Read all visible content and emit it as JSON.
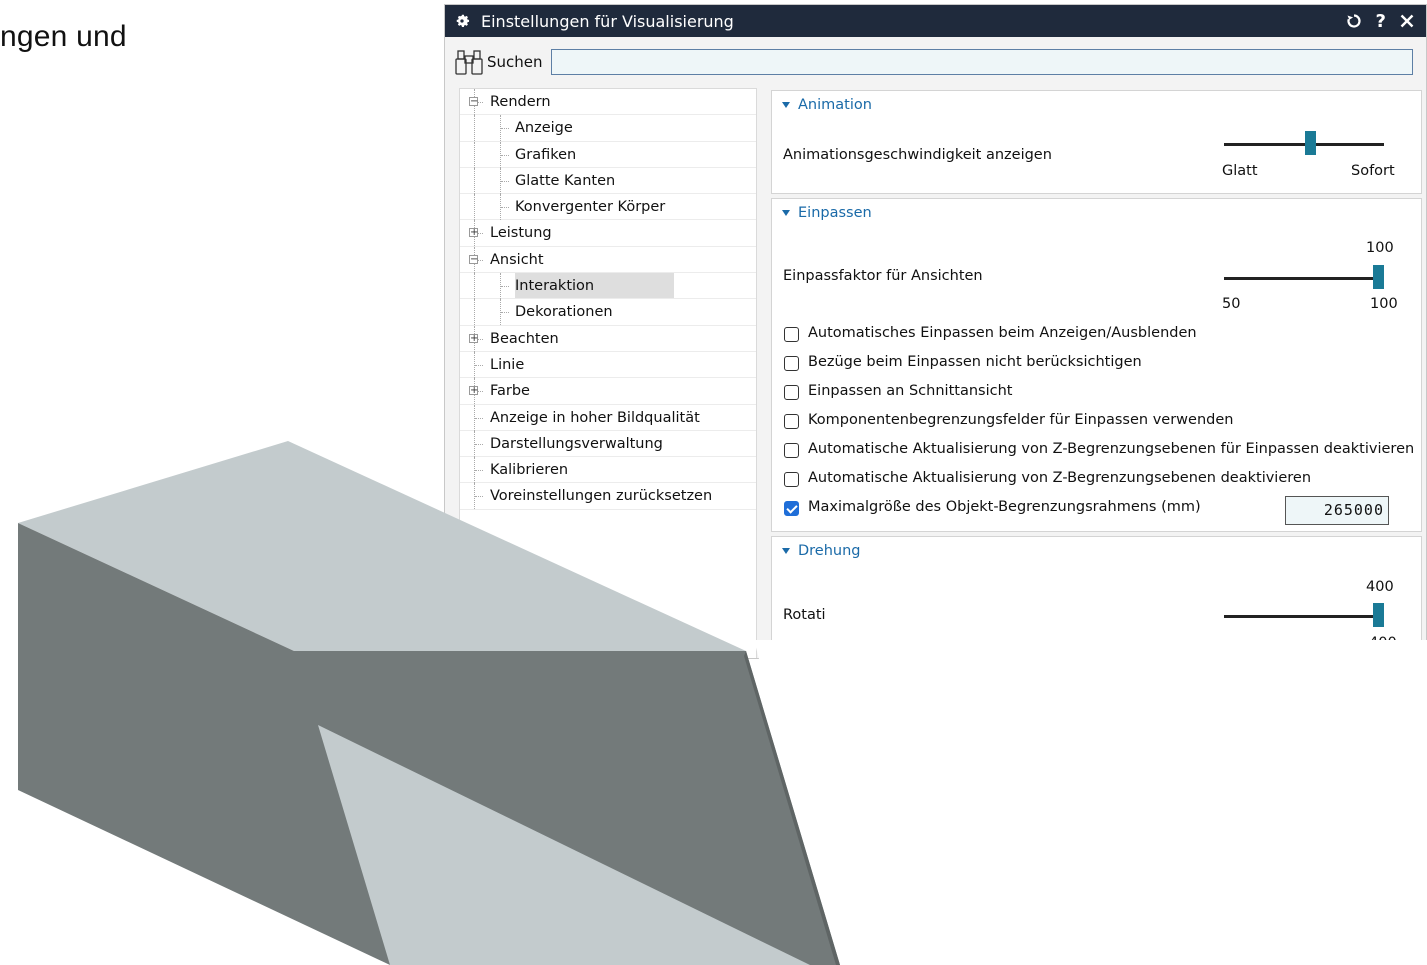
{
  "background": {
    "text": "ngen und"
  },
  "dialog": {
    "title": "Einstellungen für Visualisierung",
    "icons": [
      "gear-icon",
      "reset-icon",
      "help-icon",
      "close-icon"
    ],
    "help_label": "?",
    "search": {
      "label": "Suchen",
      "value": "",
      "placeholder": ""
    }
  },
  "tree": {
    "items": [
      {
        "label": "Rendern",
        "level": 0,
        "expander": "−"
      },
      {
        "label": "Anzeige",
        "level": 1
      },
      {
        "label": "Grafiken",
        "level": 1
      },
      {
        "label": "Glatte Kanten",
        "level": 1
      },
      {
        "label": "Konvergenter Körper",
        "level": 1
      },
      {
        "label": "Leistung",
        "level": 0,
        "expander": "+"
      },
      {
        "label": "Ansicht",
        "level": 0,
        "expander": "−"
      },
      {
        "label": "Interaktion",
        "level": 1,
        "selected": true
      },
      {
        "label": "Dekorationen",
        "level": 1
      },
      {
        "label": "Beachten",
        "level": 0,
        "expander": "+"
      },
      {
        "label": "Linie",
        "level": 0
      },
      {
        "label": "Farbe",
        "level": 0,
        "expander": "+"
      },
      {
        "label": "Anzeige in hoher Bildqualität",
        "level": 0
      },
      {
        "label": "Darstellungsverwaltung",
        "level": 0
      },
      {
        "label": "Kalibrieren",
        "level": 0
      },
      {
        "label": "Voreinstellungen zurücksetzen",
        "level": 0
      }
    ]
  },
  "animation": {
    "header": "Animation",
    "label": "Animationsgeschwindigkeit anzeigen",
    "min_label": "Glatt",
    "max_label": "Sofort",
    "value_fraction": 0.5
  },
  "einpassen": {
    "header": "Einpassen",
    "slider_label": "Einpassfaktor für Ansichten",
    "value": "100",
    "min": "50",
    "max": "100",
    "checkboxes": [
      {
        "label": "Automatisches Einpassen beim Anzeigen/Ausblenden",
        "checked": false
      },
      {
        "label": "Bezüge beim Einpassen nicht berücksichtigen",
        "checked": false
      },
      {
        "label": "Einpassen an Schnittansicht",
        "checked": false
      },
      {
        "label": "Komponentenbegrenzungsfelder für Einpassen verwenden",
        "checked": false
      },
      {
        "label": "Automatische Aktualisierung von Z-Begrenzungsebenen für Einpassen deaktivieren",
        "checked": false
      },
      {
        "label": "Automatische Aktualisierung von Z-Begrenzungsebenen deaktivieren",
        "checked": false
      },
      {
        "label": "Maximalgröße des Objekt-Begrenzungsrahmens (mm)",
        "checked": true
      }
    ],
    "max_size_value": "265000"
  },
  "drehung": {
    "header": "Drehung",
    "slider_label": "Rotati",
    "value": "400",
    "max": "400"
  },
  "colors": {
    "titlebar": "#1f2a3c",
    "accent": "#1a6aa8",
    "slider_thumb": "#1a7a96",
    "model_light": "#c3cbcd",
    "model_dark": "#737a7a"
  }
}
